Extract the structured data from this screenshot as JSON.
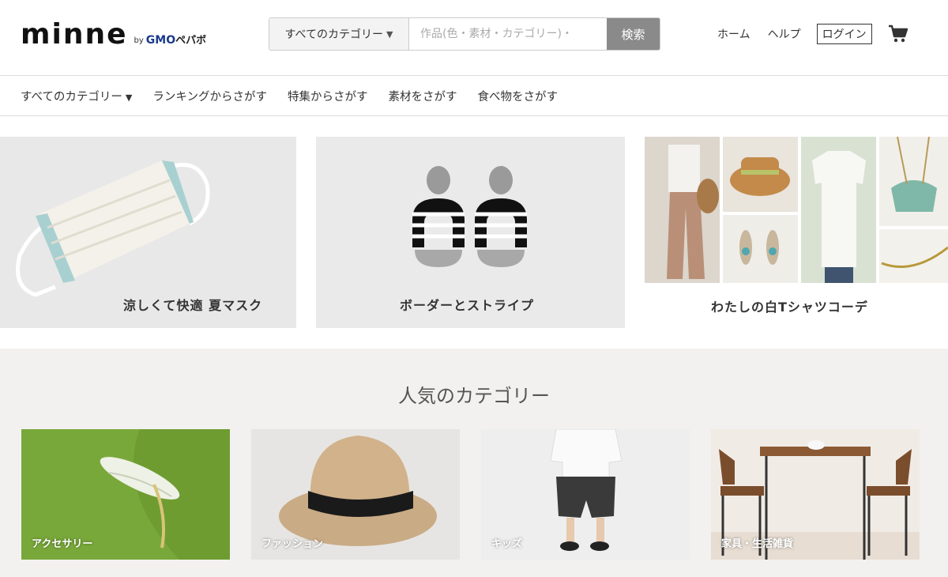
{
  "header": {
    "logo": {
      "main": "minne",
      "by": "by",
      "gmo": "GMO",
      "pepabo": "ペパボ"
    },
    "search": {
      "category": "すべてのカテゴリー",
      "placeholder": "作品(色・素材・カテゴリー)・",
      "button": "検索"
    },
    "nav": {
      "home": "ホーム",
      "help": "ヘルプ",
      "login": "ログイン"
    },
    "icons": {
      "cart": "cart-icon",
      "caret": "caret-down-icon"
    }
  },
  "category_nav": {
    "all": "すべてのカテゴリー",
    "items": [
      "ランキングからさがす",
      "特集からさがす",
      "素材をさがす",
      "食べ物をさがす"
    ]
  },
  "features": [
    {
      "caption": "涼しくて快適 夏マスク"
    },
    {
      "caption": "ボーダーとストライプ"
    },
    {
      "caption": "わたしの白Tシャツコーデ"
    }
  ],
  "popular": {
    "title": "人気のカテゴリー",
    "cards": [
      {
        "label": "アクセサリー"
      },
      {
        "label": "ファッション"
      },
      {
        "label": "キッズ"
      },
      {
        "label": "家具・生活雑貨"
      }
    ]
  }
}
